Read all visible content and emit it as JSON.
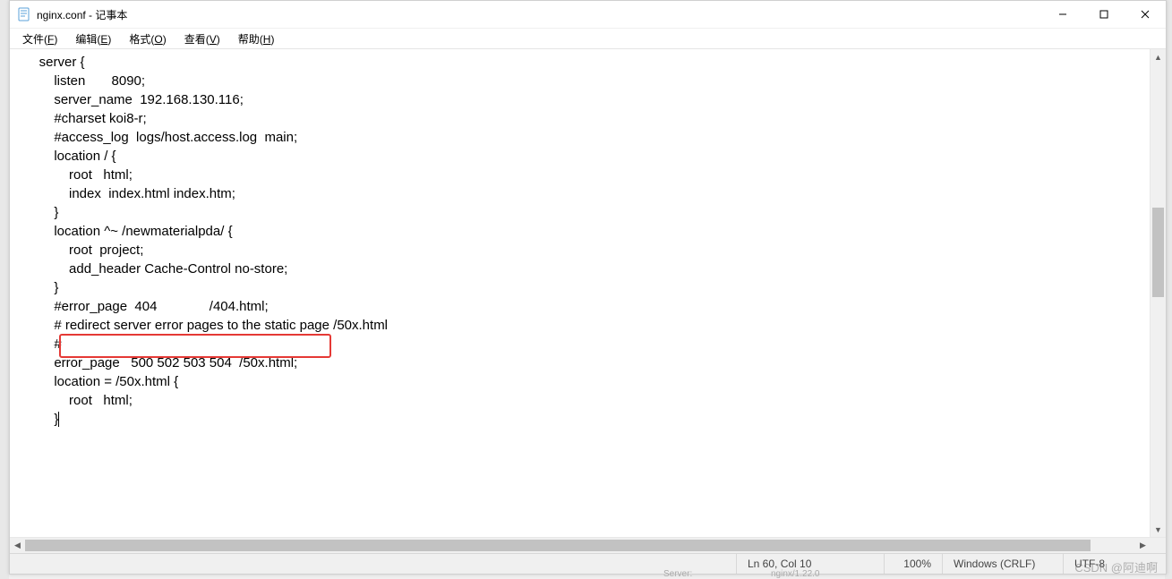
{
  "window": {
    "title": "nginx.conf - 记事本",
    "controls": {
      "minimize": "—",
      "maximize": "□",
      "close": "✕"
    }
  },
  "menubar": {
    "file": {
      "label": "文件",
      "key": "F"
    },
    "edit": {
      "label": "编辑",
      "key": "E"
    },
    "format": {
      "label": "格式",
      "key": "O"
    },
    "view": {
      "label": "查看",
      "key": "V"
    },
    "help": {
      "label": "帮助",
      "key": "H"
    }
  },
  "content": {
    "lines": [
      "    server {",
      "        listen       8090;",
      "        server_name  192.168.130.116;",
      "",
      "        #charset koi8-r;",
      "",
      "        #access_log  logs/host.access.log  main;",
      "",
      "        location / {",
      "            root   html;",
      "            index  index.html index.htm;",
      "        }",
      "",
      "        location ^~ /newmaterialpda/ {",
      "            root  project;",
      "            add_header Cache-Control no-store;",
      "        }",
      "",
      "        #error_page  404              /404.html;",
      "",
      "        # redirect server error pages to the static page /50x.html",
      "        #",
      "        error_page   500 502 503 504  /50x.html;",
      "        location = /50x.html {",
      "            root   html;",
      "        }"
    ],
    "highlight_line_index": 15
  },
  "scroll": {
    "v_thumb_top_pct": 32,
    "v_thumb_height_pct": 20,
    "h_thumb_left_pct": 0,
    "h_thumb_width_pct": 96
  },
  "statusbar": {
    "position": "Ln 60, Col 10",
    "zoom": "100%",
    "line_ending": "Windows (CRLF)",
    "encoding": "UTF-8"
  },
  "watermark": "CSDN @阿迪啊",
  "background_hint": {
    "server_label": "Server:",
    "server_value": "nginx/1.22.0"
  }
}
